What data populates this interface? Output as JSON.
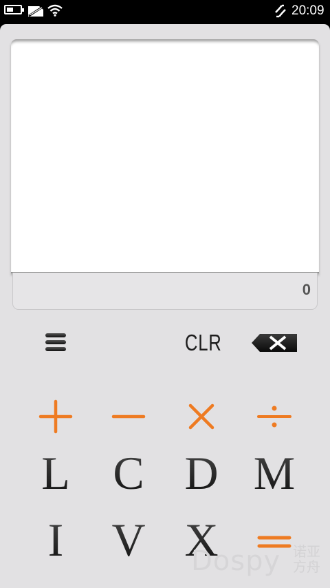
{
  "status_bar": {
    "time": "20:09",
    "icons": [
      "battery-icon",
      "no-sim-icon",
      "wifi-icon",
      "data-transfer-icon"
    ]
  },
  "display": {
    "expression": "",
    "result": "0"
  },
  "controls": {
    "menu_icon": "hamburger-menu-icon",
    "clear_label": "CLR",
    "backspace_icon": "backspace-icon"
  },
  "operators": [
    {
      "name": "plus",
      "symbol": "+"
    },
    {
      "name": "minus",
      "symbol": "−"
    },
    {
      "name": "multiply",
      "symbol": "×"
    },
    {
      "name": "divide",
      "symbol": "÷"
    },
    {
      "name": "equals",
      "symbol": "="
    }
  ],
  "numeral_keys": {
    "row1": [
      "L",
      "C",
      "D",
      "M"
    ],
    "row2": [
      "I",
      "V",
      "X"
    ]
  },
  "watermark": {
    "text": "Dospy",
    "text_cn": "诺亚方舟"
  },
  "colors": {
    "accent_orange": "#ee7b22",
    "background": "#e2e1e3",
    "display_bg": "#ffffff",
    "status_bar": "#000000"
  }
}
